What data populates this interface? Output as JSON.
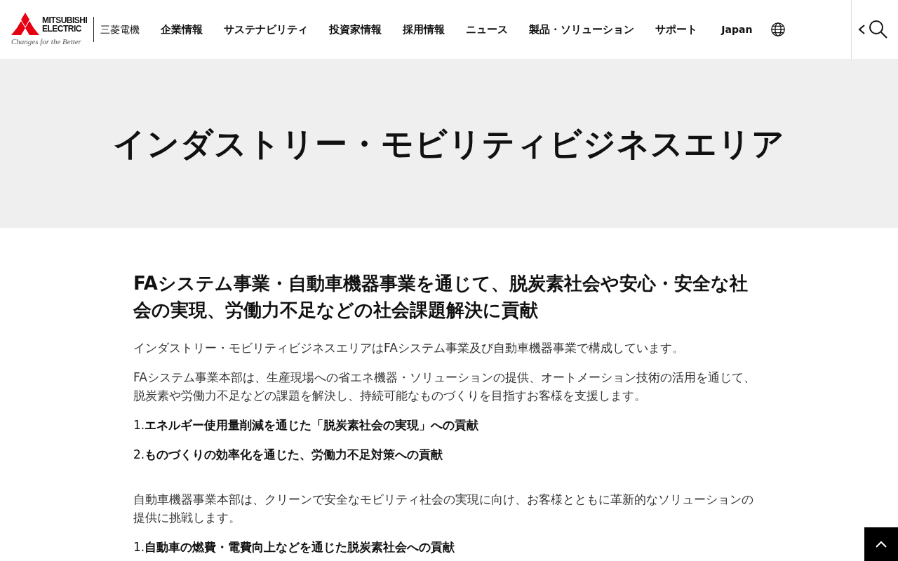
{
  "header": {
    "logo": {
      "brand_line_1": "MITSUBISHI",
      "brand_line_2": "ELECTRIC",
      "tagline": "Changes for the Better",
      "company_name": "三菱電機"
    },
    "nav": [
      "企業情報",
      "サステナビリティ",
      "投資家情報",
      "採用情報",
      "ニュース",
      "製品・ソリューション",
      "サポート"
    ],
    "region": "Japan"
  },
  "hero": {
    "title": "インダストリー・モビリティビジネスエリア"
  },
  "content": {
    "heading": "FAシステム事業・自動車機器事業を通じて、脱炭素社会や安心・安全な社会の実現、労働力不足などの社会課題解決に貢献",
    "blocks": [
      {
        "kind": "paragraph",
        "text": "インダストリー・モビリティビジネスエリアはFAシステム事業及び自動車機器事業で構成しています。"
      },
      {
        "kind": "paragraph",
        "text": "FAシステム事業本部は、生産現場への省エネ機器・ソリューションの提供、オートメーション技術の活用を通じて、脱炭素や労働力不足などの課題を解決し、持続可能なものづくりを目指すお客様を支援します。"
      },
      {
        "kind": "point",
        "text": "1.**エネルギー使用量削減を通じた「脱炭素社会の実現」への貢献**"
      },
      {
        "kind": "point",
        "text": "2.**ものづくりの効率化を通じた、労働力不足対策への貢献**"
      },
      {
        "kind": "paragraph",
        "text": "自動車機器事業本部は、クリーンで安全なモビリティ社会の実現に向け、お客様とともに革新的なソリューションの提供に挑戦します。"
      },
      {
        "kind": "point",
        "text": "1.**自動車の燃費・電費向上などを通じた脱炭素社会への貢献**"
      }
    ]
  }
}
